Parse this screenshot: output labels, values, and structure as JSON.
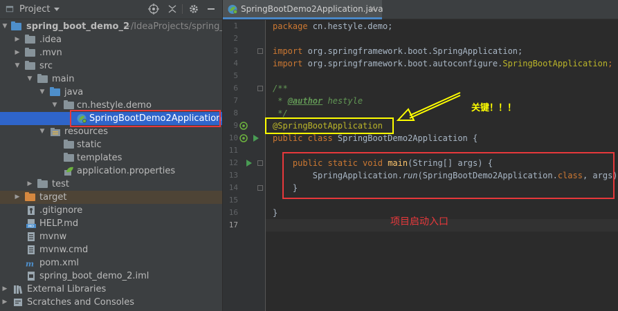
{
  "project_panel": {
    "title": "Project",
    "header_buttons": [
      "crosshair-icon",
      "collapse-icon",
      "gear-icon",
      "hide-icon"
    ],
    "tree": [
      {
        "label": "spring_boot_demo_2",
        "extra": "~/IdeaProjects/spring_b",
        "icon": "module-folder-icon",
        "expanded": true
      },
      {
        "label": ".idea",
        "icon": "folder-icon",
        "expanded": false
      },
      {
        "label": ".mvn",
        "icon": "folder-icon",
        "expanded": false
      },
      {
        "label": "src",
        "icon": "folder-icon",
        "expanded": true
      },
      {
        "label": "main",
        "icon": "folder-icon",
        "expanded": true
      },
      {
        "label": "java",
        "icon": "source-folder-icon",
        "expanded": true
      },
      {
        "label": "cn.hestyle.demo",
        "icon": "package-icon",
        "expanded": true
      },
      {
        "label": "SpringBootDemo2Application",
        "icon": "spring-boot-class-icon",
        "selected": true
      },
      {
        "label": "resources",
        "icon": "resources-folder-icon",
        "expanded": true
      },
      {
        "label": "static",
        "icon": "folder-icon"
      },
      {
        "label": "templates",
        "icon": "folder-icon"
      },
      {
        "label": "application.properties",
        "icon": "spring-properties-icon"
      },
      {
        "label": "test",
        "icon": "folder-icon",
        "expanded": false
      },
      {
        "label": "target",
        "icon": "excluded-folder-icon",
        "expanded": false
      },
      {
        "label": ".gitignore",
        "icon": "gitignore-file-icon"
      },
      {
        "label": "HELP.md",
        "icon": "markdown-file-icon"
      },
      {
        "label": "mvnw",
        "icon": "text-file-icon"
      },
      {
        "label": "mvnw.cmd",
        "icon": "text-file-icon"
      },
      {
        "label": "pom.xml",
        "icon": "maven-file-icon"
      },
      {
        "label": "spring_boot_demo_2.iml",
        "icon": "iml-file-icon"
      },
      {
        "label": "External Libraries",
        "icon": "libraries-icon",
        "expanded": false
      },
      {
        "label": "Scratches and Consoles",
        "icon": "scratches-icon",
        "expanded": false
      }
    ]
  },
  "editor": {
    "tab": {
      "label": "SpringBootDemo2Application.java",
      "close": "×",
      "icon": "spring-boot-class-icon"
    },
    "line_numbers": [
      "1",
      "2",
      "3",
      "4",
      "5",
      "6",
      "7",
      "8",
      "9",
      "10",
      "11",
      "12",
      "13",
      "14",
      "15",
      "16",
      "17"
    ],
    "code": {
      "l1_kw": "package",
      "l1_rest": " cn.hestyle.demo;",
      "l3_kw": "import",
      "l3_rest": " org.springframework.boot.SpringApplication;",
      "l4_kw": "import",
      "l4_rest": " org.springframework.boot.autoconfigure.",
      "l4_ann": "SpringBootApplication",
      "l4_end": ";",
      "l6": "/**",
      "l7_a": " * ",
      "l7_tag": "@author",
      "l7_b": " hestyle",
      "l8": " */",
      "l9": "@SpringBootApplication",
      "l10_kw": "public class",
      "l10_rest": " SpringBootDemo2Application {",
      "l12_kw": "    public static void",
      "l12_sp": " ",
      "l12_fn": "main",
      "l12_rest": "(String[] args) {",
      "l13_a": "        SpringApplication.",
      "l13_run": "run",
      "l13_b": "(SpringBootDemo2Application.",
      "l13_kw": "class",
      "l13_c": ", args)",
      "l13_end": ";",
      "l14": "    }",
      "l16": "}"
    }
  },
  "annotations": {
    "key_label": "关键！！！",
    "entry_label": "项目启动入口",
    "colors": {
      "yellow": "#ffff00",
      "red": "#e8383b"
    }
  }
}
